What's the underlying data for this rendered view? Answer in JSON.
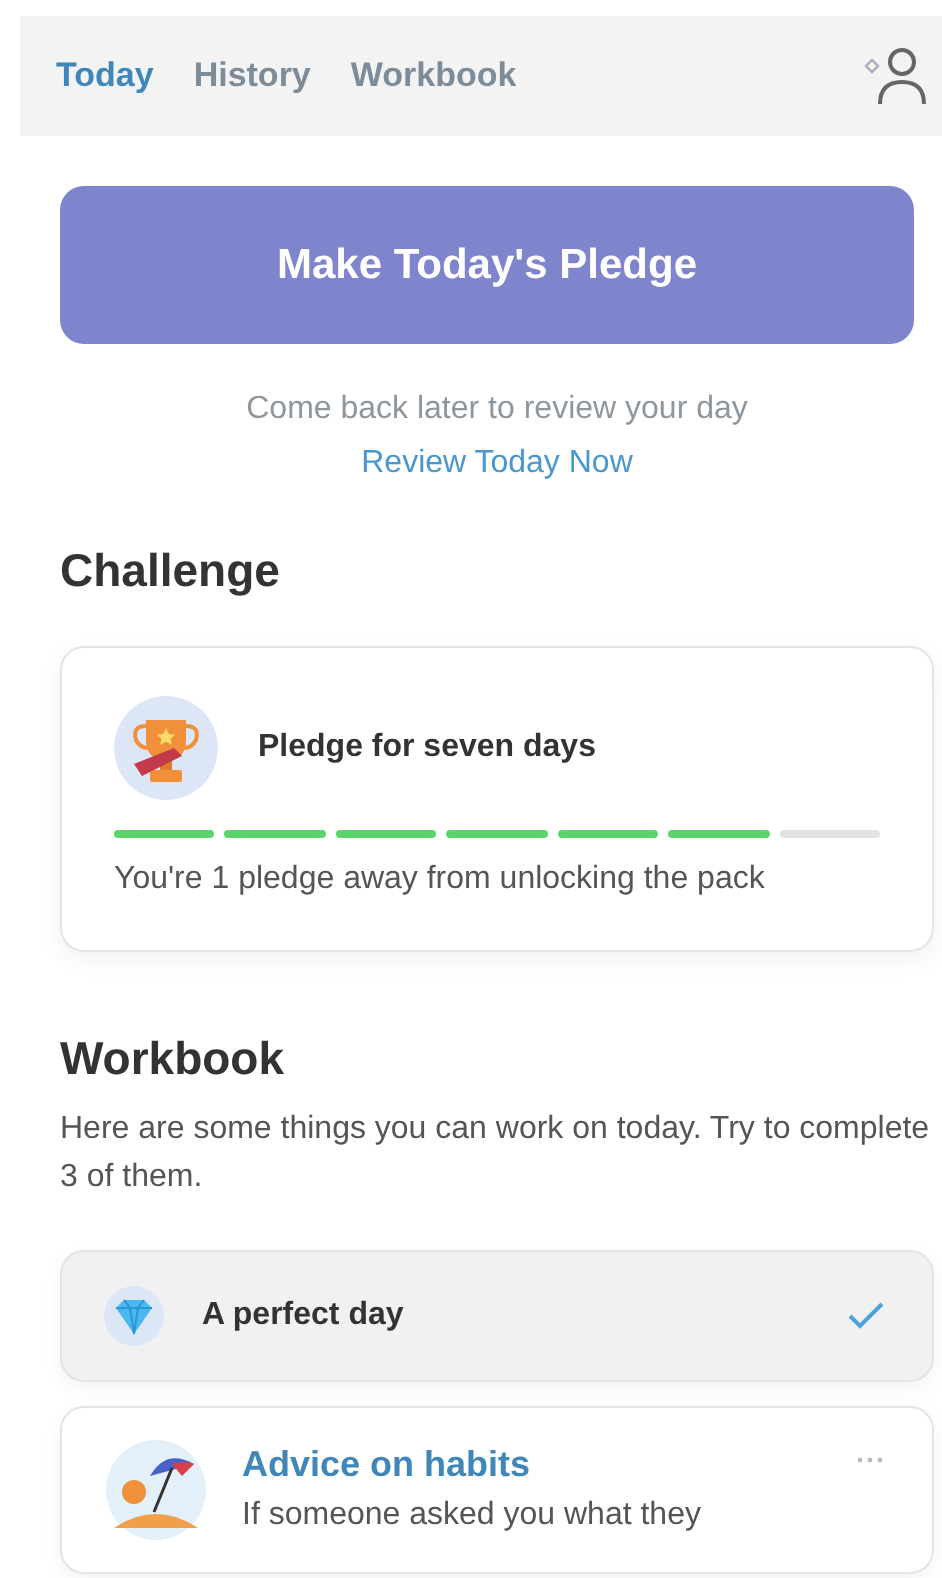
{
  "tabs": [
    {
      "label": "Today",
      "selected": true
    },
    {
      "label": "History",
      "selected": false
    },
    {
      "label": "Workbook",
      "selected": false
    }
  ],
  "pledge_button": "Make Today's Pledge",
  "review_note": "Come back later to review your day",
  "review_link": "Review Today Now",
  "challenge": {
    "heading": "Challenge",
    "title": "Pledge for seven days",
    "segments": [
      {
        "filled": true
      },
      {
        "filled": true
      },
      {
        "filled": true
      },
      {
        "filled": true
      },
      {
        "filled": true
      },
      {
        "filled": true
      },
      {
        "filled": false
      }
    ],
    "message": "You're 1 pledge away from unlocking the pack"
  },
  "workbook": {
    "heading": "Workbook",
    "intro": "Here are some things you can work on today. Try to complete 3 of them.",
    "items": [
      {
        "kind": "diamond",
        "title": "A perfect day",
        "completed": true
      },
      {
        "kind": "umbrella",
        "title": "Advice on habits",
        "completed": false,
        "description": "If someone asked you what they"
      }
    ]
  }
}
